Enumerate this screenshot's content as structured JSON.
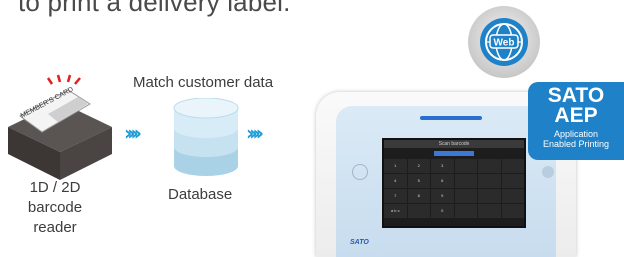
{
  "heading": "to print a delivery label.",
  "reader": {
    "card_text": "MEMBER'S CARD",
    "label_line1": "1D / 2D",
    "label_line2": "barcode",
    "label_line3": "reader"
  },
  "flow": {
    "match_label": "Match customer data",
    "arrow_left": "››››",
    "arrow_right": "››››"
  },
  "database": {
    "label": "Database"
  },
  "printer": {
    "screen_title": "Scan barcode",
    "keys": [
      "1",
      "2",
      "3",
      "",
      "",
      "",
      "4",
      "5",
      "6",
      "",
      "",
      "",
      "7",
      "8",
      "9",
      "",
      "",
      "",
      "a b c",
      "",
      "0",
      "",
      "",
      ""
    ],
    "brand": "SATO"
  },
  "web_badge": {
    "label": "Web"
  },
  "aep_badge": {
    "line1": "SATO",
    "line2": "AEP",
    "line3": "Application",
    "line4": "Enabled Printing"
  },
  "colors": {
    "arrow": "#1d9cd8",
    "badge_blue": "#1f82c8",
    "database": "#bcdcec"
  }
}
